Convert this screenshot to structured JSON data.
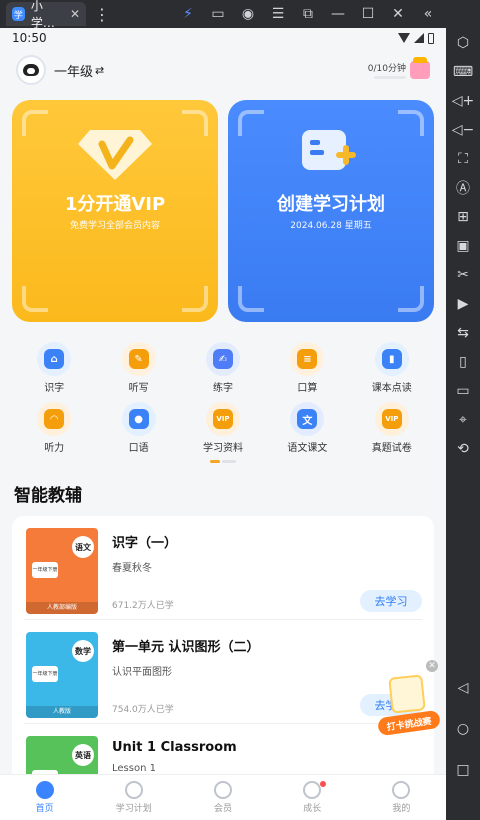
{
  "emulator": {
    "tab_title": "小学…",
    "tab_close": "✕",
    "menu_dots": "⋮",
    "app_icon_letter": "学",
    "toolbar_icons": [
      "lightning-icon",
      "gamepad-icon",
      "user-icon",
      "menu-icon",
      "external-icon",
      "minimize-icon",
      "maximize-icon",
      "close-icon",
      "collapse-icon"
    ],
    "right_icons": [
      "settings-icon",
      "keyboard-icon",
      "volume-up-icon",
      "volume-down-icon",
      "screenshot-icon",
      "auto-icon",
      "add-icon",
      "apk-icon",
      "cut-icon",
      "video-icon",
      "switch-icon",
      "shake-icon",
      "folder-icon",
      "location-icon",
      "rotate-icon"
    ],
    "nav_icons": [
      "back-icon",
      "home-icon",
      "recent-icon"
    ]
  },
  "status": {
    "time": "10:50"
  },
  "header": {
    "grade": "一年级",
    "switch_glyph": "⇄",
    "study_time": "0/10分钟",
    "study_progress": 0
  },
  "cards": {
    "vip": {
      "title": "1分开通VIP",
      "subtitle": "免费学习全部会员内容",
      "color": "#fbb91c"
    },
    "plan": {
      "title": "创建学习计划",
      "subtitle": "2024.06.28 星期五",
      "color": "#3a7bf2"
    }
  },
  "grid": [
    {
      "label": "识字",
      "bg": "#e4efff",
      "fg": "#3b82f6",
      "glyph": "⌂"
    },
    {
      "label": "听写",
      "bg": "#fff1dd",
      "fg": "#f59e0b",
      "glyph": "✎"
    },
    {
      "label": "练字",
      "bg": "#e3ecff",
      "fg": "#4f7cf7",
      "glyph": "✍"
    },
    {
      "label": "口算",
      "bg": "#fff1dd",
      "fg": "#f59e0b",
      "glyph": "≡"
    },
    {
      "label": "课本点读",
      "bg": "#e3f0ff",
      "fg": "#3b82f6",
      "glyph": "▮"
    },
    {
      "label": "听力",
      "bg": "#fff0db",
      "fg": "#f59e0b",
      "glyph": "◠"
    },
    {
      "label": "口语",
      "bg": "#e3f0ff",
      "fg": "#3b82f6",
      "glyph": "●"
    },
    {
      "label": "学习资料",
      "bg": "#fff0db",
      "fg": "#f59e0b",
      "glyph": "VIP"
    },
    {
      "label": "语文课文",
      "bg": "#e3ecff",
      "fg": "#3b82f6",
      "glyph": "文"
    },
    {
      "label": "真题试卷",
      "bg": "#fff0db",
      "fg": "#f59e0b",
      "glyph": "VIP"
    }
  ],
  "section": {
    "title": "智能教辅"
  },
  "courses": [
    {
      "title": "识字（一）",
      "subtitle": "春夏秋冬",
      "count": "671.2万人已学",
      "button": "去学习",
      "cover_tag": "语文",
      "cover_label": "一年级下册",
      "cover_pub": "人教部编版",
      "cover_color": "#f47b3a"
    },
    {
      "title": "第一单元 认识图形（二）",
      "subtitle": "认识平面图形",
      "count": "754.0万人已学",
      "button": "去学习",
      "cover_tag": "数学",
      "cover_label": "一年级下册",
      "cover_pub": "人教版",
      "cover_color": "#3bb7e8"
    },
    {
      "title": "Unit 1 Classroom",
      "subtitle": "Lesson 1",
      "count": "",
      "button": "",
      "cover_tag": "英语",
      "cover_label": "一年级",
      "cover_pub": "",
      "cover_color": "#57c259"
    }
  ],
  "float_badge": {
    "text": "打卡挑战赛",
    "close": "✕"
  },
  "bottom_nav": [
    {
      "label": "首页",
      "active": true
    },
    {
      "label": "学习计划",
      "active": false
    },
    {
      "label": "会员",
      "active": false
    },
    {
      "label": "成长",
      "active": false,
      "dot": true
    },
    {
      "label": "我的",
      "active": false
    }
  ]
}
